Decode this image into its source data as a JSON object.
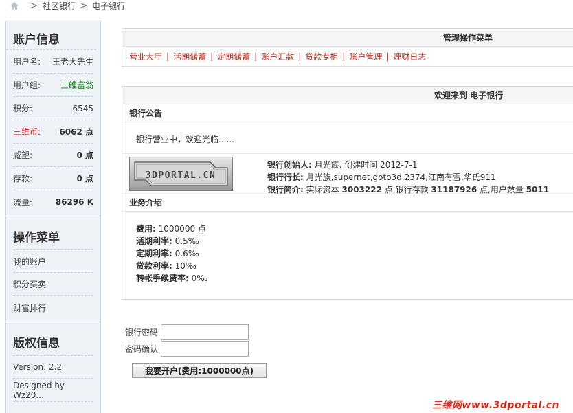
{
  "breadcrumb": {
    "items": [
      "社区银行",
      "电子银行"
    ],
    "separator": ">"
  },
  "sidebar": {
    "account_title": "账户信息",
    "account_rows": [
      {
        "key": "用户名:",
        "value": "王老大先生",
        "style": "normal"
      },
      {
        "key": "用户组:",
        "value": "三维富翁",
        "style": "green"
      },
      {
        "key": "积分:",
        "value": "6545",
        "style": "normal"
      },
      {
        "key": "三维币:",
        "value": "6062 点",
        "style": "bold-redkey"
      },
      {
        "key": "威望:",
        "value": "0 点",
        "style": "bold"
      },
      {
        "key": "存款:",
        "value": "0 点",
        "style": "bold"
      },
      {
        "key": "流量:",
        "value": "86296 K",
        "style": "bold"
      }
    ],
    "ops_title": "操作菜单",
    "ops_items": [
      "我的账户",
      "积分买卖",
      "财富排行"
    ],
    "copyright_title": "版权信息",
    "copyright_rows": [
      "Version: 2.2",
      "Designed by Wz20..."
    ]
  },
  "main": {
    "menu_title": "管理操作菜单",
    "menu_items": [
      "营业大厅",
      "活期储蓄",
      "定期储蓄",
      "账户汇款",
      "贷款专柜",
      "账户管理",
      "理财日志"
    ],
    "welcome_title": "欢迎来到 电子银行",
    "notice_title": "银行公告",
    "notice_text": "银行营业中，欢迎光临......",
    "logo_text": "3DPORTAL.CN",
    "founder_label": "银行创始人:",
    "founder_value": "月光族, 创建时间 2012-7-1",
    "president_label": "银行行长:",
    "president_value": "月光族,supernet,goto3d,2374,江南有雪,华氏911",
    "intro_label": "银行简介:",
    "intro_prefix": "实际资本",
    "intro_capital": "3003222",
    "intro_mid1": "点,银行存款",
    "intro_deposit": "31187926",
    "intro_mid2": "点,用户数量",
    "intro_users": "5011",
    "biz_title": "业务介绍",
    "biz_rows": [
      {
        "label": "费用:",
        "value": "1000000 点"
      },
      {
        "label": "活期利率:",
        "value": "0.5‰"
      },
      {
        "label": "定期利率:",
        "value": "0.6‰"
      },
      {
        "label": "贷款利率:",
        "value": "10‰"
      },
      {
        "label": "转帐手续费率:",
        "value": "0‰"
      }
    ]
  },
  "form": {
    "password_label": "银行密码",
    "confirm_label": "密码确认",
    "password_value": "",
    "confirm_value": "",
    "submit_label": "我要开户(费用:1000000点)"
  },
  "watermark": "三维网www.3dportal.cn",
  "colors": {
    "link_red": "#c0281a",
    "group_green": "#1a8a1a",
    "sidebar_bg": "#eef3f8"
  }
}
